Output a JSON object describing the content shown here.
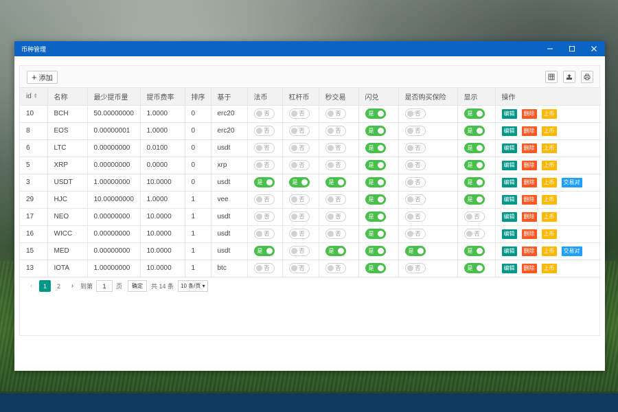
{
  "window": {
    "title": "币种管理"
  },
  "toolbar": {
    "add_label": "添加",
    "icons": [
      "columns-icon",
      "export-icon",
      "print-icon"
    ]
  },
  "colors": {
    "titlebar": "#0b63c4",
    "switch_on": "#4bbf4b",
    "edit": "#009688",
    "delete": "#ff5722",
    "list": "#ffb800",
    "pair": "#1e9fff"
  },
  "table": {
    "headers": [
      "id",
      "名称",
      "最少提币量",
      "提币费率",
      "排序",
      "基于",
      "法币",
      "杠杆币",
      "秒交易",
      "闪兑",
      "是否购买保险",
      "显示",
      "操作"
    ],
    "switch_on_text": "是",
    "switch_off_text": "否",
    "actions": {
      "edit": "编辑",
      "delete": "删除",
      "list": "上币",
      "pair": "交易对"
    },
    "rows": [
      {
        "id": "10",
        "name": "BCH",
        "min": "50.00000000",
        "fee": "1.0000",
        "sort": "0",
        "base": "erc20",
        "fiat": false,
        "lever": false,
        "second": false,
        "flash": true,
        "insurance": false,
        "show": true,
        "pair": false
      },
      {
        "id": "8",
        "name": "EOS",
        "min": "0.00000001",
        "fee": "1.0000",
        "sort": "0",
        "base": "erc20",
        "fiat": false,
        "lever": false,
        "second": false,
        "flash": true,
        "insurance": false,
        "show": true,
        "pair": false
      },
      {
        "id": "6",
        "name": "LTC",
        "min": "0.00000000",
        "fee": "0.0100",
        "sort": "0",
        "base": "usdt",
        "fiat": false,
        "lever": false,
        "second": false,
        "flash": true,
        "insurance": false,
        "show": true,
        "pair": false
      },
      {
        "id": "5",
        "name": "XRP",
        "min": "0.00000000",
        "fee": "0.0000",
        "sort": "0",
        "base": "xrp",
        "fiat": false,
        "lever": false,
        "second": false,
        "flash": true,
        "insurance": false,
        "show": true,
        "pair": false
      },
      {
        "id": "3",
        "name": "USDT",
        "min": "1.00000000",
        "fee": "10.0000",
        "sort": "0",
        "base": "usdt",
        "fiat": true,
        "lever": true,
        "second": true,
        "flash": true,
        "insurance": false,
        "show": true,
        "pair": true
      },
      {
        "id": "29",
        "name": "HJC",
        "min": "10.00000000",
        "fee": "1.0000",
        "sort": "1",
        "base": "vee",
        "fiat": false,
        "lever": false,
        "second": false,
        "flash": true,
        "insurance": false,
        "show": true,
        "pair": false
      },
      {
        "id": "17",
        "name": "NEO",
        "min": "0.00000000",
        "fee": "10.0000",
        "sort": "1",
        "base": "usdt",
        "fiat": false,
        "lever": false,
        "second": false,
        "flash": true,
        "insurance": false,
        "show": false,
        "pair": false
      },
      {
        "id": "16",
        "name": "WICC",
        "min": "0.00000000",
        "fee": "10.0000",
        "sort": "1",
        "base": "usdt",
        "fiat": false,
        "lever": false,
        "second": false,
        "flash": true,
        "insurance": false,
        "show": false,
        "pair": false
      },
      {
        "id": "15",
        "name": "MED",
        "min": "0.00000000",
        "fee": "10.0000",
        "sort": "1",
        "base": "usdt",
        "fiat": true,
        "lever": false,
        "second": true,
        "flash": true,
        "insurance": true,
        "show": true,
        "pair": true
      },
      {
        "id": "13",
        "name": "IOTA",
        "min": "1.00000000",
        "fee": "10.0000",
        "sort": "1",
        "base": "btc",
        "fiat": false,
        "lever": false,
        "second": false,
        "flash": true,
        "insurance": false,
        "show": true,
        "pair": false
      }
    ]
  },
  "pager": {
    "pages": [
      "1",
      "2"
    ],
    "current": "1",
    "goto_label": "到第",
    "goto_value": "1",
    "page_unit": "页",
    "confirm_label": "确定",
    "total_label": "共 14 条",
    "size_label": "10 条/页"
  }
}
